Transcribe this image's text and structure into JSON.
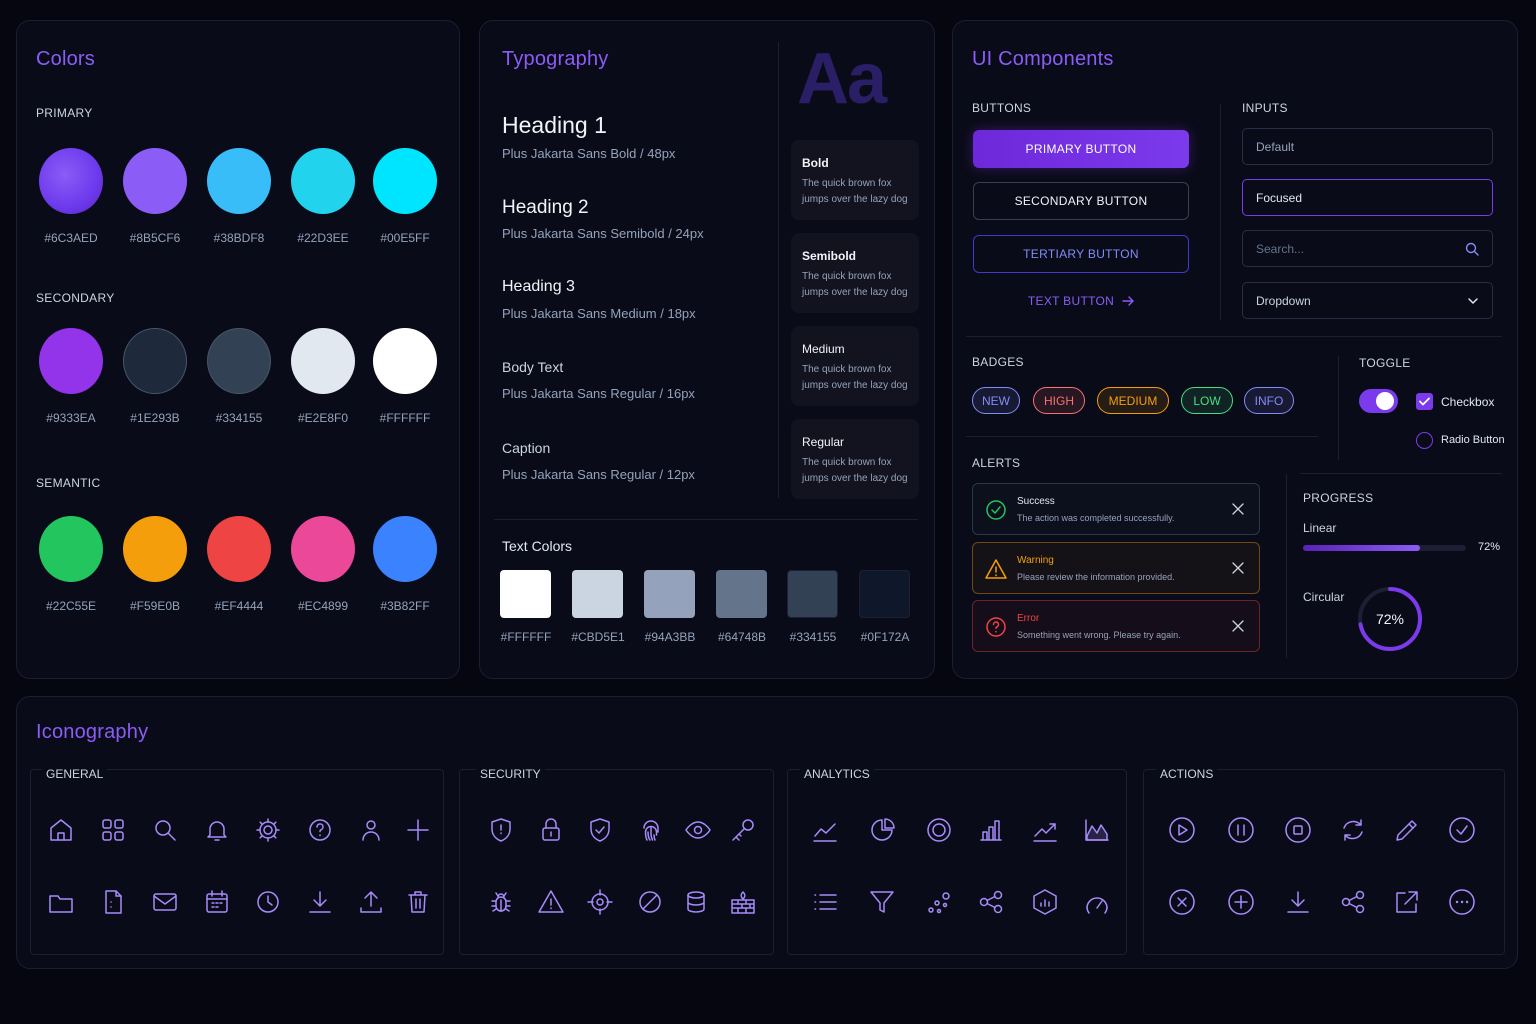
{
  "colors": {
    "title": "Colors",
    "primary_label": "PRIMARY",
    "secondary_label": "SECONDARY",
    "semantic_label": "SEMANTIC",
    "primary": [
      {
        "hex": "#6C3AED",
        "label": "#6C3AED"
      },
      {
        "hex": "#8B5CF6",
        "label": "#8B5CF6"
      },
      {
        "hex": "#38BDF8",
        "label": "#38BDF8"
      },
      {
        "hex": "#22D3EE",
        "label": "#22D3EE"
      },
      {
        "hex": "#00E5FF",
        "label": "#00E5FF"
      }
    ],
    "secondary": [
      {
        "hex": "#9333EA",
        "label": "#9333EA"
      },
      {
        "hex": "#1E293B",
        "label": "#1E293B"
      },
      {
        "hex": "#334155",
        "label": "#334155"
      },
      {
        "hex": "#E2E8F0",
        "label": "#E2E8F0"
      },
      {
        "hex": "#FFFFFF",
        "label": "#FFFFFF"
      }
    ],
    "semantic": [
      {
        "hex": "#22C55E",
        "label": "#22C55E"
      },
      {
        "hex": "#F59E0B",
        "label": "#F59E0B"
      },
      {
        "hex": "#EF4444",
        "label": "#EF4444"
      },
      {
        "hex": "#EC4899",
        "label": "#EC4899"
      },
      {
        "hex": "#3B82FF",
        "label": "#3B82FF"
      }
    ]
  },
  "typography": {
    "title": "Typography",
    "specimen": "Aa",
    "styles": [
      {
        "name": "Heading 1",
        "spec": "Plus Jakarta Sans Bold / 48px"
      },
      {
        "name": "Heading 2",
        "spec": "Plus Jakarta Sans Semibold / 24px"
      },
      {
        "name": "Heading 3",
        "spec": "Plus Jakarta Sans Medium / 18px"
      },
      {
        "name": "Body Text",
        "spec": "Plus Jakarta Sans Regular / 16px"
      },
      {
        "name": "Caption",
        "spec": "Plus Jakarta Sans Regular / 12px"
      }
    ],
    "weights": [
      {
        "name": "Bold",
        "sample": "The quick brown fox jumps over the lazy dog"
      },
      {
        "name": "Semibold",
        "sample": "The quick brown fox jumps over the lazy dog"
      },
      {
        "name": "Medium",
        "sample": "The quick brown fox jumps over the lazy dog"
      },
      {
        "name": "Regular",
        "sample": "The quick brown fox jumps over the lazy dog"
      }
    ],
    "text_colors_label": "Text Colors",
    "text_colors": [
      {
        "hex": "#FFFFFF",
        "label": "#FFFFFF"
      },
      {
        "hex": "#CBD5E1",
        "label": "#CBD5E1"
      },
      {
        "hex": "#94A3BB",
        "label": "#94A3BB"
      },
      {
        "hex": "#64748B",
        "label": "#64748B"
      },
      {
        "hex": "#334155",
        "label": "#334155"
      },
      {
        "hex": "#0F172A",
        "label": "#0F172A"
      }
    ]
  },
  "components": {
    "title": "UI Components",
    "buttons_label": "BUTTONS",
    "primary_button": "PRIMARY BUTTON",
    "secondary_button": "SECONDARY BUTTON",
    "tertiary_button": "TERTIARY BUTTON",
    "text_button": "TEXT BUTTON",
    "inputs_label": "INPUTS",
    "input_default": "Default",
    "input_focused": "Focused",
    "search_placeholder": "Search...",
    "dropdown_value": "Dropdown",
    "badges_label": "BADGES",
    "badges": [
      {
        "text": "NEW",
        "color": "#818cf8"
      },
      {
        "text": "HIGH",
        "color": "#f87171"
      },
      {
        "text": "MEDIUM",
        "color": "#f59e0b"
      },
      {
        "text": "LOW",
        "color": "#4ade80"
      },
      {
        "text": "INFO",
        "color": "#818cf8"
      }
    ],
    "toggle_label": "TOGGLE",
    "toggle_on": true,
    "checkbox_label": "Checkbox",
    "checkbox_checked": true,
    "radio_label": "Radio Button",
    "radio_checked": false,
    "alerts_label": "ALERTS",
    "alerts": [
      {
        "title": "Success",
        "message": "The action was completed successfully.",
        "color": "#22c55e",
        "kind": "success"
      },
      {
        "title": "Warning",
        "message": "Please review the information provided.",
        "color": "#f59e0b",
        "kind": "warning"
      },
      {
        "title": "Error",
        "message": "Something went wrong. Please try again.",
        "color": "#ef4444",
        "kind": "error"
      }
    ],
    "progress_label": "PROGRESS",
    "linear_label": "Linear",
    "linear_value": 72,
    "linear_text": "72%",
    "circular_label": "Circular",
    "circular_value": 72,
    "circular_text": "72%"
  },
  "iconography": {
    "title": "Iconography",
    "groups": [
      {
        "label": "GENERAL",
        "icons": [
          "home-icon",
          "grid-icon",
          "search-icon",
          "bell-icon",
          "gear-icon",
          "help-icon",
          "user-icon",
          "plus-icon",
          "folder-icon",
          "file-icon",
          "mail-icon",
          "calendar-icon",
          "clock-icon",
          "download-icon",
          "upload-icon",
          "trash-icon"
        ]
      },
      {
        "label": "SECURITY",
        "icons": [
          "shield-icon",
          "lock-icon",
          "shield-check-icon",
          "fingerprint-icon",
          "eye-icon",
          "key-icon",
          "bug-icon",
          "warning-icon",
          "target-icon",
          "block-icon",
          "database-icon",
          "firewall-icon"
        ]
      },
      {
        "label": "ANALYTICS",
        "icons": [
          "line-chart-icon",
          "pie-chart-icon",
          "donut-icon",
          "bar-chart-icon",
          "trend-up-icon",
          "area-chart-icon",
          "list-icon",
          "filter-icon",
          "scatter-icon",
          "share-nodes-icon",
          "hexagon-chart-icon",
          "gauge-icon"
        ]
      },
      {
        "label": "ACTIONS",
        "icons": [
          "play-icon",
          "pause-icon",
          "stop-icon",
          "refresh-icon",
          "edit-icon",
          "check-circle-icon",
          "close-circle-icon",
          "add-circle-icon",
          "download-icon",
          "share-icon",
          "external-link-icon",
          "more-icon"
        ]
      }
    ]
  }
}
